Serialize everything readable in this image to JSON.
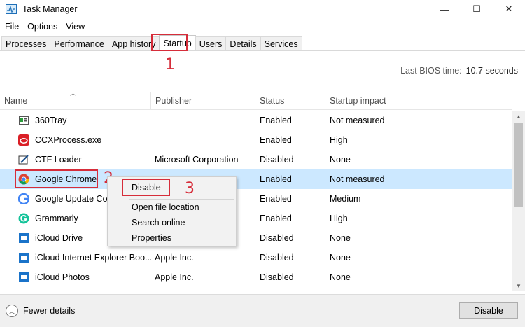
{
  "window": {
    "title": "Task Manager",
    "controls": {
      "minimize": "—",
      "maximize": "☐",
      "close": "✕"
    }
  },
  "menu": [
    "File",
    "Options",
    "View"
  ],
  "tabs": [
    "Processes",
    "Performance",
    "App history",
    "Startup",
    "Users",
    "Details",
    "Services"
  ],
  "active_tab": "Startup",
  "bios": {
    "label": "Last BIOS time:",
    "value": "10.7 seconds"
  },
  "columns": {
    "name": "Name",
    "publisher": "Publisher",
    "status": "Status",
    "impact": "Startup impact"
  },
  "rows": [
    {
      "icon": "360tray-icon",
      "name": "360Tray",
      "publisher": "",
      "status": "Enabled",
      "impact": "Not measured"
    },
    {
      "icon": "creative-cloud-icon",
      "name": "CCXProcess.exe",
      "publisher": "",
      "status": "Enabled",
      "impact": "High"
    },
    {
      "icon": "ctf-loader-icon",
      "name": "CTF Loader",
      "publisher": "Microsoft Corporation",
      "status": "Disabled",
      "impact": "None"
    },
    {
      "icon": "chrome-icon",
      "name": "Google Chrome",
      "publisher": "",
      "status": "Enabled",
      "impact": "Not measured"
    },
    {
      "icon": "google-update-icon",
      "name": "Google Update Core",
      "publisher": "",
      "status": "Enabled",
      "impact": "Medium"
    },
    {
      "icon": "grammarly-icon",
      "name": "Grammarly",
      "publisher": "",
      "status": "Enabled",
      "impact": "High"
    },
    {
      "icon": "icloud-icon",
      "name": "iCloud Drive",
      "publisher": "",
      "status": "Disabled",
      "impact": "None"
    },
    {
      "icon": "icloud-icon",
      "name": "iCloud Internet Explorer Boo...",
      "publisher": "Apple Inc.",
      "status": "Disabled",
      "impact": "None"
    },
    {
      "icon": "icloud-icon",
      "name": "iCloud Photos",
      "publisher": "Apple Inc.",
      "status": "Disabled",
      "impact": "None"
    }
  ],
  "selected_row": "Google Chrome",
  "context_menu": [
    "Disable",
    "Open file location",
    "Search online",
    "Properties"
  ],
  "footer": {
    "fewer_details": "Fewer details",
    "disable_button": "Disable"
  },
  "annotations": [
    "1",
    "2",
    "3"
  ],
  "colors": {
    "highlight_red": "#d62d3a",
    "selection_blue": "#cce8ff"
  }
}
